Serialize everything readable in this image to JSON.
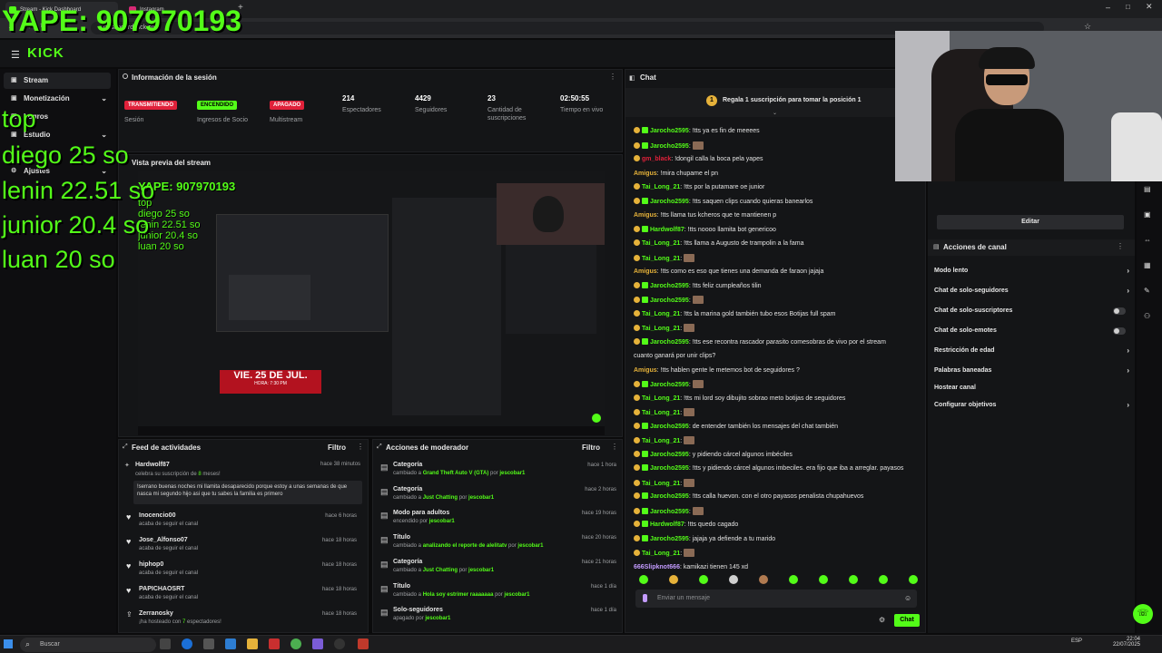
{
  "browser": {
    "tabs": [
      {
        "label": "Stream - Kick Dashboard"
      },
      {
        "label": "Instagram"
      }
    ],
    "url": "dashboard.kick.com"
  },
  "overlay": {
    "yape": "YAPE: 907970193",
    "top_label": "top",
    "ranking": [
      "diego 25 so",
      "lenin 22.51 so",
      "junior 20.4 so",
      "luan 20 so"
    ]
  },
  "kick": {
    "logo": "KICK"
  },
  "sidebar": {
    "items": [
      {
        "label": "Stream",
        "icon": "stream-icon"
      },
      {
        "label": "Monetización",
        "icon": "dollar-icon"
      },
      {
        "label": "Logros",
        "icon": "trophy-icon"
      },
      {
        "label": "Estudio",
        "icon": "studio-icon"
      },
      {
        "label": "Ajustes",
        "icon": "gear-icon"
      }
    ]
  },
  "info": {
    "title": "Información de la sesión",
    "statuses": [
      {
        "badge": "TRANSMITIENDO",
        "label": "Sesión",
        "color": "#e0213a"
      },
      {
        "badge": "ENCENDIDO",
        "label": "Ingresos de Socio",
        "color": "#53fc18"
      },
      {
        "badge": "APAGADO",
        "label": "Multistream",
        "color": "#e0213a"
      }
    ],
    "stats": [
      {
        "value": "214",
        "label": "Espectadores"
      },
      {
        "value": "4429",
        "label": "Seguidores"
      },
      {
        "value": "23",
        "label": "Cantidad de suscripciones"
      },
      {
        "value": "02:50:55",
        "label": "Tiempo en vivo"
      }
    ]
  },
  "preview": {
    "title": "Vista previa del stream",
    "yape": "YAPE: 907970193",
    "ranking": [
      "top",
      "diego 25 so",
      "lenin 22.51 so",
      "junior 20.4 so",
      "luan 20 so"
    ],
    "banner": "VIE. 25 DE JUL.",
    "banner_sub": "HORA: 7:30 PM"
  },
  "activity": {
    "title": "Feed de actividades",
    "filter": "Filtro",
    "highlight": {
      "user": "Hardwolf87",
      "time": "hace 38 minutos",
      "desc_pre": "celebra su suscripción de ",
      "desc_num": "8",
      "desc_post": " meses!",
      "message": "!serrano buenas noches mi llamita desaparecido porque estoy a unas semanas de que nasca mi segundo hijo asi que tu sabes la familia es primero"
    },
    "items": [
      {
        "user": "Inocencio00",
        "desc": "acaba de seguir el canal",
        "time": "hace 6 horas"
      },
      {
        "user": "Jose_Alfonso07",
        "desc": "acaba de seguir el canal",
        "time": "hace 18 horas"
      },
      {
        "user": "hiphop0",
        "desc": "acaba de seguir el canal",
        "time": "hace 18 horas"
      },
      {
        "user": "PAPICHAOSRT",
        "desc": "acaba de seguir el canal",
        "time": "hace 18 horas"
      },
      {
        "user": "Zerranosky",
        "desc_pre": "¡ha hosteado con ",
        "desc_num": "7",
        "desc_post": " espectadores!",
        "time": "hace 18 horas"
      }
    ]
  },
  "modactions": {
    "title": "Acciones de moderador",
    "filter": "Filtro",
    "items": [
      {
        "title": "Categoría",
        "pre": "cambiado a ",
        "value": "Grand Theft Auto V (GTA)",
        "by": "jescobar1",
        "time": "hace 1 hora"
      },
      {
        "title": "Categoría",
        "pre": "cambiado a ",
        "value": "Just Chatting",
        "by": "jescobar1",
        "time": "hace 2 horas"
      },
      {
        "title": "Modo para adultos",
        "pre": "encendido",
        "value": "",
        "by": "jescobar1",
        "time": "hace 19 horas"
      },
      {
        "title": "Título",
        "pre": "cambiado a ",
        "value": "analizando el reporte de alelitatv",
        "by": "jescobar1",
        "time": "hace 20 horas"
      },
      {
        "title": "Categoría",
        "pre": "cambiado a ",
        "value": "Just Chatting",
        "by": "jescobar1",
        "time": "hace 21 horas"
      },
      {
        "title": "Título",
        "pre": "cambiado a ",
        "value": "Hola soy estrimer raaaaaaa",
        "by": "jescobar1",
        "time": "hace 1 día"
      },
      {
        "title": "Solo-seguidores",
        "pre": "apagado",
        "value": "",
        "by": "jescobar1",
        "time": "hace 1 día"
      }
    ],
    "by_word": " por "
  },
  "chat": {
    "title": "Chat",
    "pinned_num": "1",
    "pinned": "Regala 1 suscripción para tomar la posición 1",
    "messages": [
      {
        "user": "Jarocho2595",
        "color": "#53fc18",
        "text": "!tts ya es fin de meeees",
        "b": 2
      },
      {
        "user": "Jarocho2595",
        "color": "#53fc18",
        "text": "",
        "b": 2,
        "emote": true
      },
      {
        "user": "gm_black",
        "color": "#e0213a",
        "text": "!dongil calla la boca pela yapes",
        "b": 1
      },
      {
        "user": "Amigus",
        "color": "#e6b23a",
        "text": "!mira chupame el pn",
        "b": 0
      },
      {
        "user": "Tai_Long_21",
        "color": "#53fc18",
        "text": "!tts por la putamare oe junior",
        "b": 1
      },
      {
        "user": "Jarocho2595",
        "color": "#53fc18",
        "text": "!tts saquen clips cuando quieras banearlos",
        "b": 2
      },
      {
        "user": "Amigus",
        "color": "#e6b23a",
        "text": "!tts llama tus kcheros que te mantienen p",
        "b": 0
      },
      {
        "user": "Hardwolf87",
        "color": "#53fc18",
        "text": "!tts noooo llamita bot genericoo",
        "b": 2
      },
      {
        "user": "Tai_Long_21",
        "color": "#53fc18",
        "text": "!tts llama a Augusto de trampolin a la fama",
        "b": 1
      },
      {
        "user": "Tai_Long_21",
        "color": "#53fc18",
        "text": "",
        "b": 1,
        "emote": true
      },
      {
        "user": "Amigus",
        "color": "#e6b23a",
        "text": "!tts como es eso que tienes una demanda de faraon jajaja",
        "b": 0
      },
      {
        "user": "Jarocho2595",
        "color": "#53fc18",
        "text": "!tts feliz cumpleaños tilin",
        "b": 2
      },
      {
        "user": "Jarocho2595",
        "color": "#53fc18",
        "text": "",
        "b": 2,
        "emote": true
      },
      {
        "user": "Tai_Long_21",
        "color": "#53fc18",
        "text": "!tts la marina gold también tubo esos Botijas full spam",
        "b": 1
      },
      {
        "user": "Tai_Long_21",
        "color": "#53fc18",
        "text": "",
        "b": 1,
        "emote": true
      },
      {
        "user": "Jarocho2595",
        "color": "#53fc18",
        "text": "!tts ese recontra rascador parasito comesobras de vivo por el stream",
        "b": 2
      },
      {
        "user": "",
        "color": "#e2e2e2",
        "text": "cuanto ganará por unir clips?",
        "b": 0
      },
      {
        "user": "Amigus",
        "color": "#e6b23a",
        "text": "!tts hablen gente le metemos bot de seguidores ?",
        "b": 0
      },
      {
        "user": "Jarocho2595",
        "color": "#53fc18",
        "text": "",
        "b": 2,
        "emote": true
      },
      {
        "user": "Tai_Long_21",
        "color": "#53fc18",
        "text": "!tts mi lord soy dibujito sobrao meto botijas de seguidores",
        "b": 1
      },
      {
        "user": "Tai_Long_21",
        "color": "#53fc18",
        "text": "",
        "b": 1,
        "emote": true
      },
      {
        "user": "Jarocho2595",
        "color": "#53fc18",
        "text": "de entender también los mensajes del chat también",
        "b": 2
      },
      {
        "user": "Tai_Long_21",
        "color": "#53fc18",
        "text": "",
        "b": 1,
        "emote": true
      },
      {
        "user": "Jarocho2595",
        "color": "#53fc18",
        "text": "y pidiendo cárcel algunos imbéciles",
        "b": 2
      },
      {
        "user": "Jarocho2595",
        "color": "#53fc18",
        "text": "!tts y pidiendo cárcel algunos imbeciles. era fijo que iba a arreglar. payasos",
        "b": 2
      },
      {
        "user": "Tai_Long_21",
        "color": "#53fc18",
        "text": "",
        "b": 1,
        "emote": true
      },
      {
        "user": "Jarocho2595",
        "color": "#53fc18",
        "text": "!tts calla huevon. con el otro payasos penalista chupahuevos",
        "b": 2
      },
      {
        "user": "Jarocho2595",
        "color": "#53fc18",
        "text": "",
        "b": 2,
        "emote": true
      },
      {
        "user": "Hardwolf87",
        "color": "#53fc18",
        "text": "!tts quedo cagado",
        "b": 2
      },
      {
        "user": "Jarocho2595",
        "color": "#53fc18",
        "text": "jajaja ya defiende a tu marido",
        "b": 2
      },
      {
        "user": "Tai_Long_21",
        "color": "#53fc18",
        "text": "",
        "b": 1,
        "emote": true
      },
      {
        "user": "666Slipknot666",
        "color": "#c39bff",
        "text": "kamikazi tienen 145 xd",
        "b": 0
      }
    ],
    "input_placeholder": "Enviar un mensaje",
    "send_label": "Chat"
  },
  "channel": {
    "edit_label": "Editar",
    "actions_title": "Acciones de canal",
    "items": [
      {
        "label": "Modo lento",
        "kind": "chevron"
      },
      {
        "label": "Chat de solo-seguidores",
        "kind": "chevron"
      },
      {
        "label": "Chat de solo-suscriptores",
        "kind": "toggle"
      },
      {
        "label": "Chat de solo-emotes",
        "kind": "toggle"
      },
      {
        "label": "Restricción de edad",
        "kind": "chevron"
      },
      {
        "label": "Palabras baneadas",
        "kind": "chevron"
      },
      {
        "label": "Hostear canal",
        "kind": "none"
      },
      {
        "label": "Configurar objetivos",
        "kind": "chevron"
      }
    ]
  },
  "taskbar": {
    "search_placeholder": "Buscar",
    "lang": "ESP",
    "time": "22:04",
    "date": "22/07/2025"
  },
  "colors": {
    "accent": "#53fc18",
    "live": "#e0213a",
    "panel": "#141517"
  }
}
